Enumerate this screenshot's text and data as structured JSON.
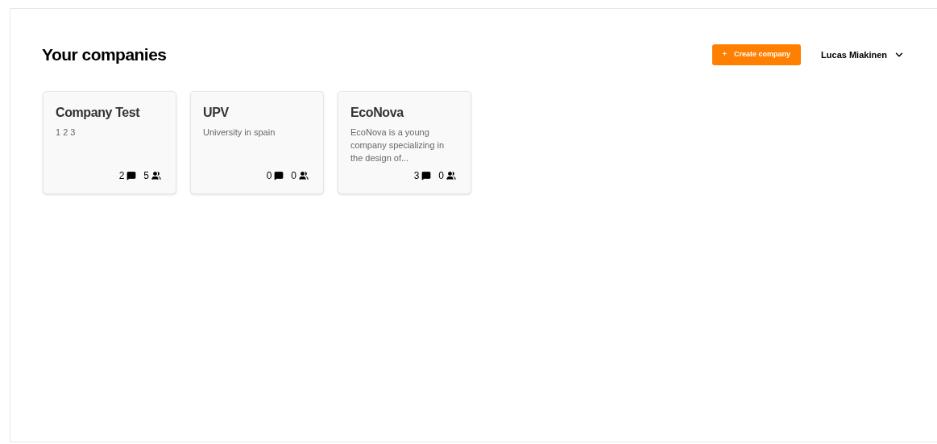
{
  "header": {
    "title": "Your companies",
    "create_button": {
      "icon": "+",
      "label": "Create company"
    },
    "user_menu": {
      "name": "Lucas Miakinen"
    }
  },
  "companies": [
    {
      "name": "Company Test",
      "description": "1 2 3",
      "chats": "2",
      "members": "5"
    },
    {
      "name": "UPV",
      "description": "University in spain",
      "chats": "0",
      "members": "0"
    },
    {
      "name": "EcoNova",
      "description": "EcoNova is a young company specializing in the design of...",
      "chats": "3",
      "members": "0"
    }
  ]
}
